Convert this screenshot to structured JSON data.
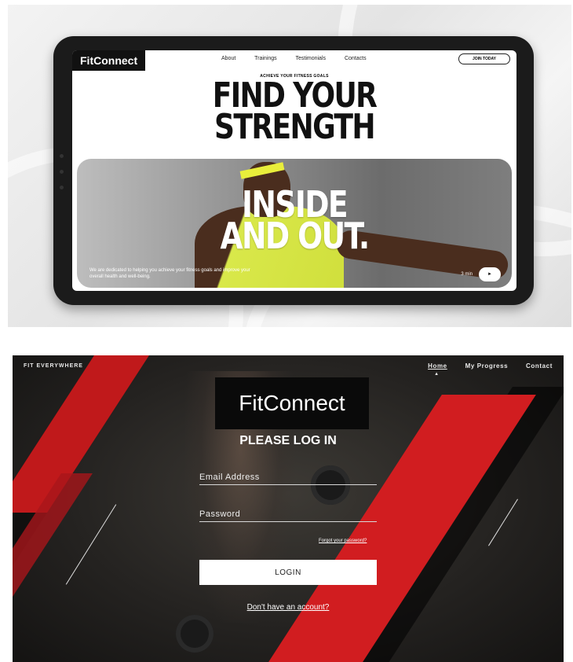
{
  "mockup": {
    "brand": "FitConnect",
    "nav": [
      "About",
      "Trainings",
      "Testimonials",
      "Contacts"
    ],
    "cta": "JOIN TODAY",
    "tagline": "ACHIEVE YOUR FITNESS GOALS",
    "headline_line1": "FIND YOUR",
    "headline_line2": "STRENGTH",
    "hero_line1": "INSIDE",
    "hero_line2": "AND OUT.",
    "hero_description": "We are dedicated to helping you achieve your fitness goals and improve your overall health and well-being.",
    "video_duration": "3 min",
    "play_icon": "►",
    "colors": {
      "accent": "#e9ee3b",
      "dark": "#111111"
    }
  },
  "login": {
    "tagline": "FIT EVERYWHERE",
    "nav": {
      "home": "Home",
      "progress": "My Progress",
      "contact": "Contact"
    },
    "caret": "▲",
    "logo": "FitConnect",
    "title": "PLEASE LOG IN",
    "email_placeholder": "Email Address",
    "password_placeholder": "Password",
    "forgot": "Forgot your password?",
    "login_button": "LOGIN",
    "signup": "Don't have an account?",
    "colors": {
      "accent": "#d11d20",
      "background": "#1f1d1b"
    }
  }
}
